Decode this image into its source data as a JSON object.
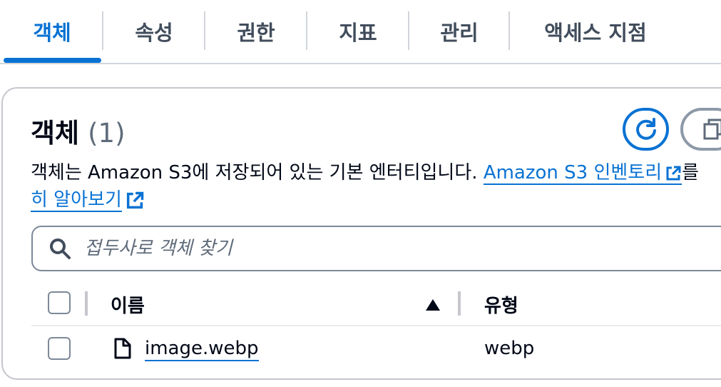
{
  "tabs": [
    {
      "label": "객체",
      "active": true
    },
    {
      "label": "속성",
      "active": false
    },
    {
      "label": "권한",
      "active": false
    },
    {
      "label": "지표",
      "active": false
    },
    {
      "label": "관리",
      "active": false
    },
    {
      "label": "액세스 지점",
      "active": false
    }
  ],
  "objects": {
    "title": "객체",
    "count": "(1)",
    "description": "객체는 Amazon S3에 저장되어 있는 기본 엔터티입니다.",
    "inventory_link": "Amazon S3 인벤토리",
    "description_tail": "를",
    "learn_more_prefix": "히 알아보기",
    "search_placeholder": "접두사로 객체 찾기",
    "columns": {
      "name": "이름",
      "type": "유형"
    },
    "rows": [
      {
        "name": "image.webp",
        "type": "webp"
      }
    ]
  },
  "icons": {
    "refresh": "refresh-icon",
    "copy": "copy-icon",
    "external": "external-link-icon",
    "search": "search-icon",
    "sort": "sort-ascending-icon",
    "file": "file-icon"
  },
  "colors": {
    "accent": "#0972d3",
    "text": "#000716",
    "muted": "#5f6b7a",
    "border": "#c6c6cd"
  }
}
